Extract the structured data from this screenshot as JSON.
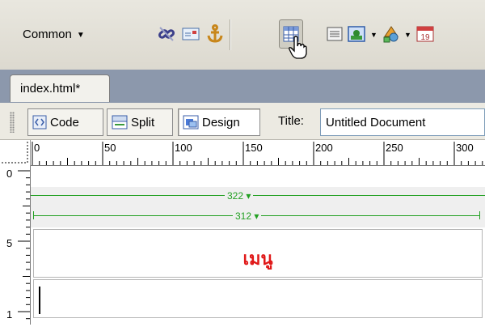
{
  "insert_bar": {
    "category": "Common",
    "icons": [
      {
        "name": "hyperlink-icon"
      },
      {
        "name": "email-link-icon"
      },
      {
        "name": "named-anchor-icon"
      },
      {
        "name": "table-icon",
        "state": "pressed"
      },
      {
        "name": "div-layer-icon"
      },
      {
        "name": "image-icon",
        "has_dropdown": true
      },
      {
        "name": "media-icon",
        "has_dropdown": true
      },
      {
        "name": "date-icon",
        "label": "19"
      }
    ]
  },
  "document_tab": {
    "filename": "index.html*"
  },
  "doc_toolbar": {
    "views": [
      {
        "label": "Code",
        "selected": false
      },
      {
        "label": "Split",
        "selected": false
      },
      {
        "label": "Design",
        "selected": true
      }
    ],
    "title_label": "Title:",
    "title_value": "Untitled Document"
  },
  "ruler": {
    "horizontal_labels": [
      "0",
      "50",
      "100",
      "150",
      "200",
      "250",
      "300"
    ],
    "vertical_labels": [
      "0",
      "5",
      "1"
    ]
  },
  "design": {
    "table_width": "322",
    "cell_width": "312",
    "menu_text": "เมนู",
    "width_marker_color": "#22a022",
    "menu_text_color": "#e01818"
  }
}
